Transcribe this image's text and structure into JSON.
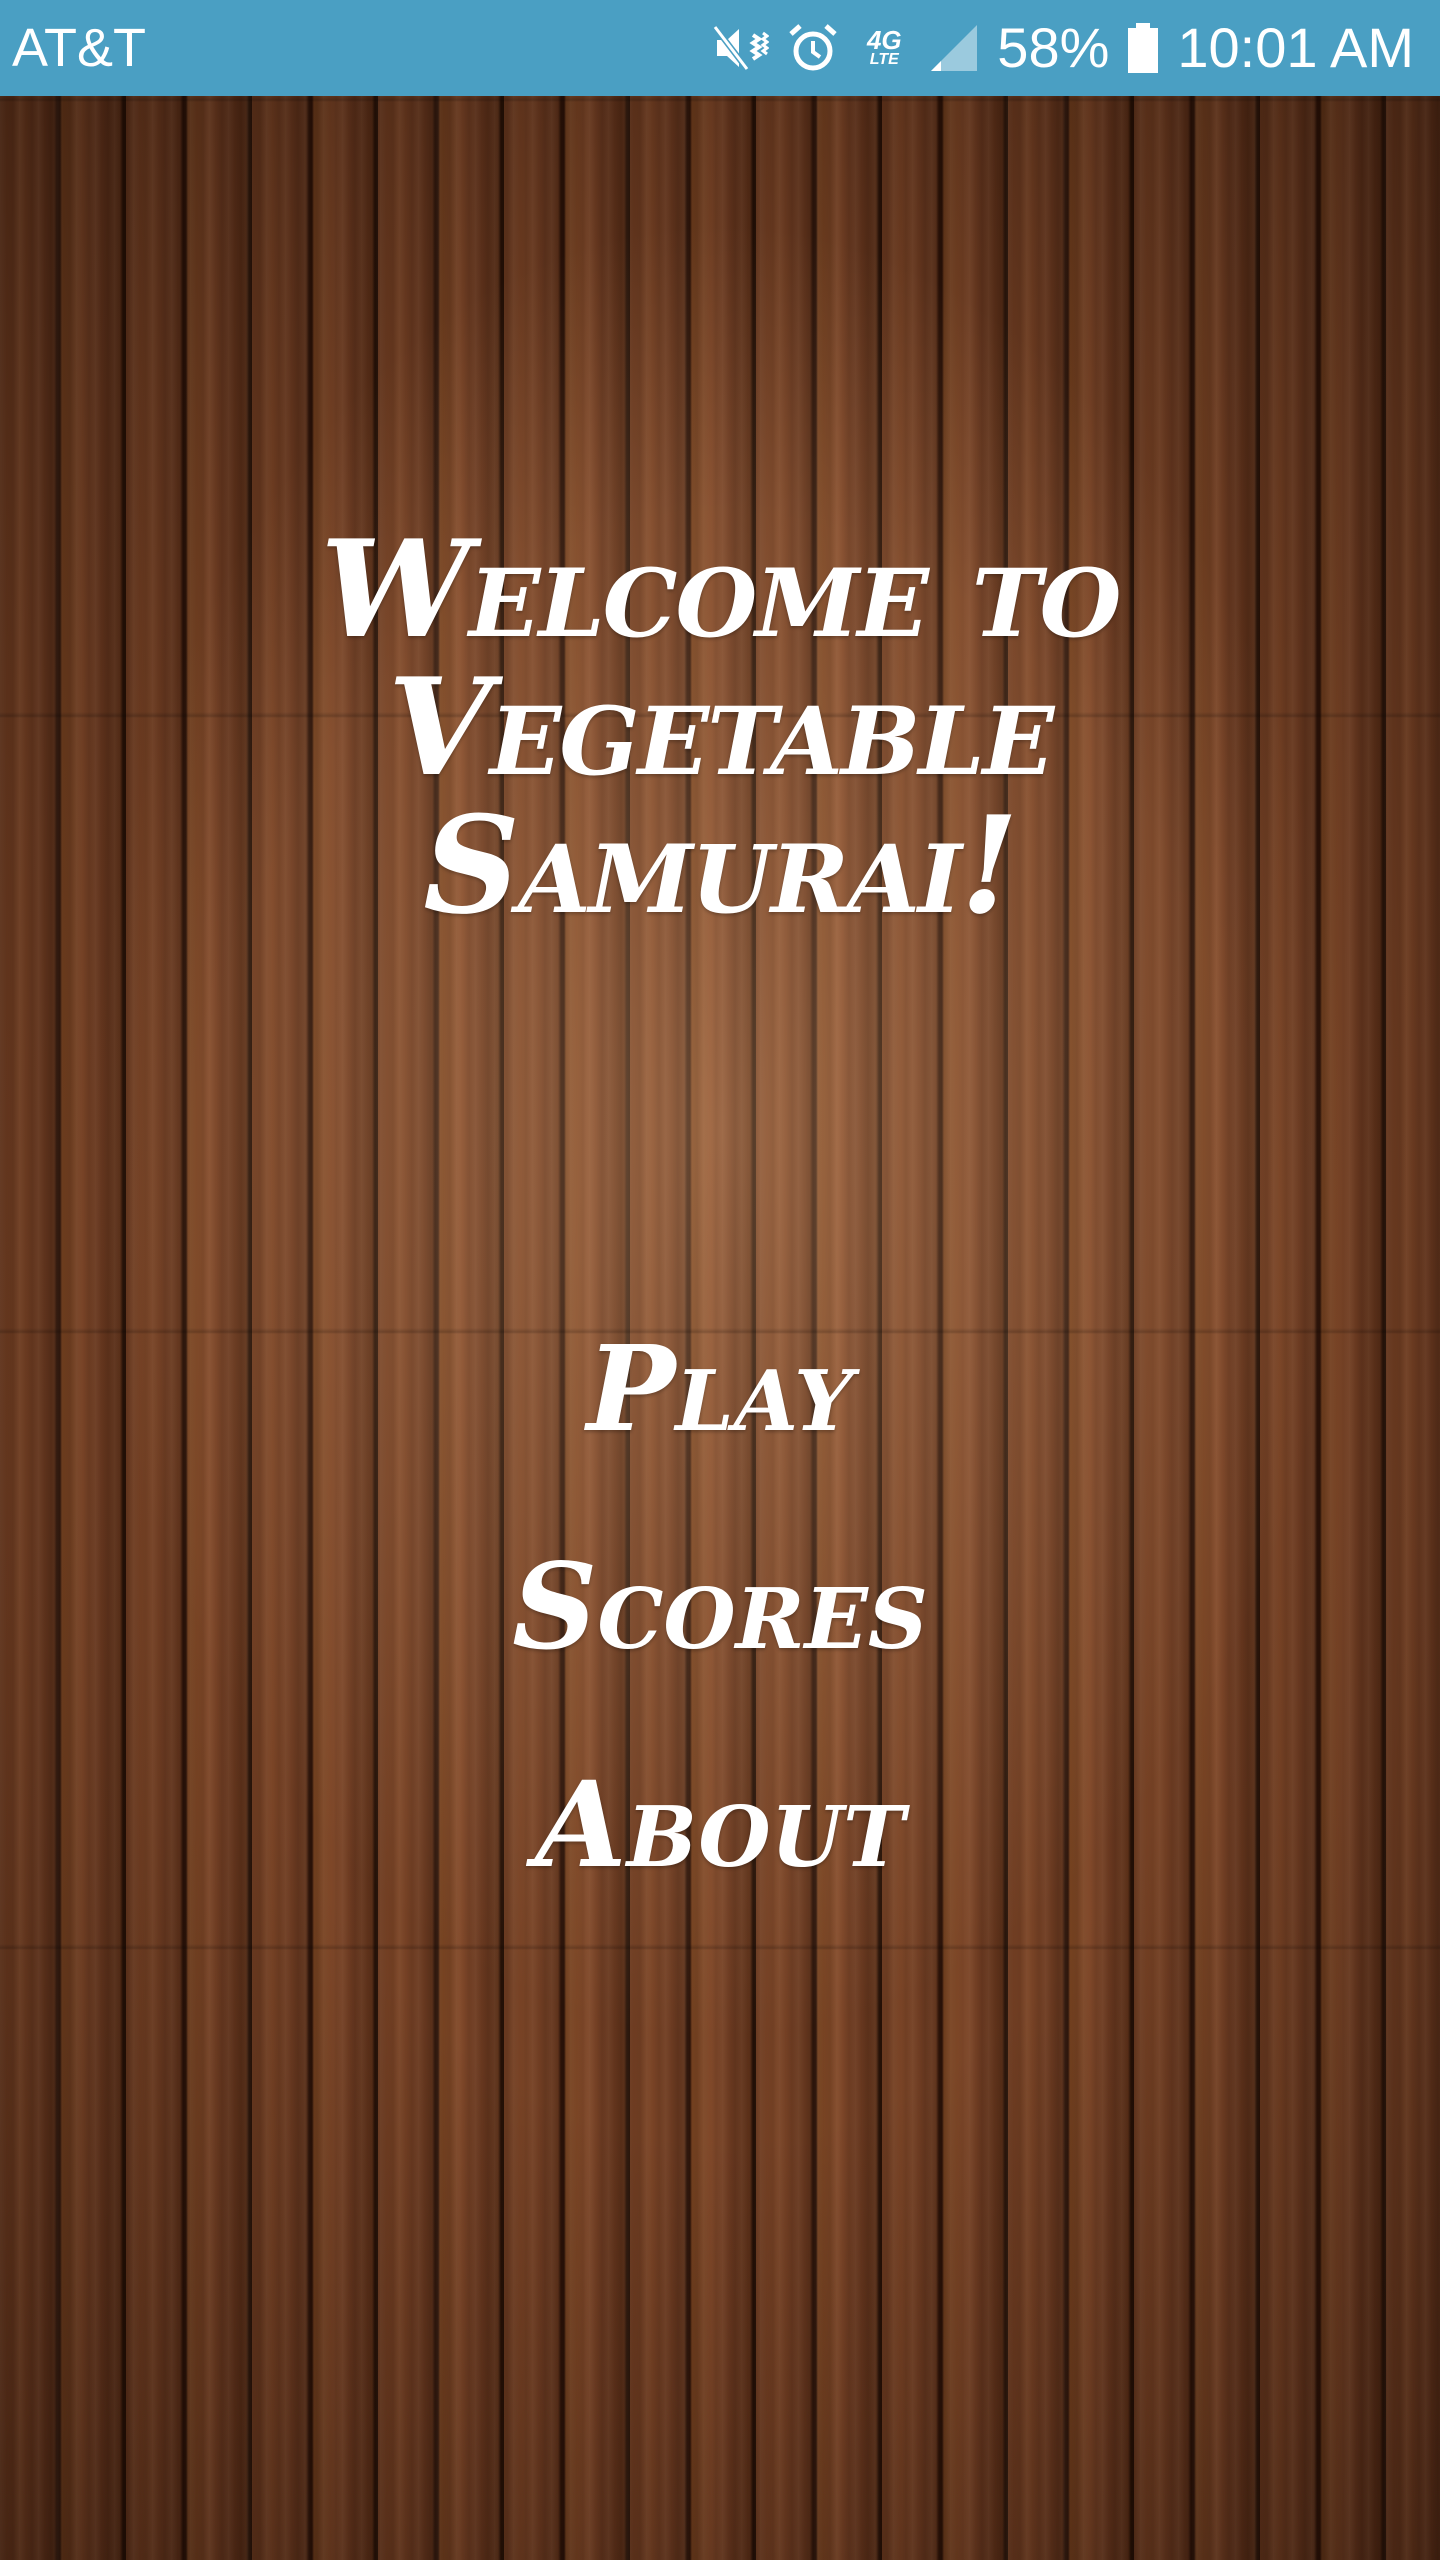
{
  "status_bar": {
    "carrier": "AT&T",
    "icons": [
      "mute-vibrate-icon",
      "alarm-icon",
      "network-4g-lte-icon",
      "signal-icon",
      "battery-icon"
    ],
    "network": "4G",
    "network_sub": "LTE",
    "battery": "58%",
    "time": "10:01 AM",
    "background_color": "#4a9fc3"
  },
  "title": {
    "line1": "Welcome to",
    "line2": "Vegetable",
    "line3": "Samurai!"
  },
  "menu": {
    "play": "Play",
    "scores": "Scores",
    "about": "About"
  }
}
